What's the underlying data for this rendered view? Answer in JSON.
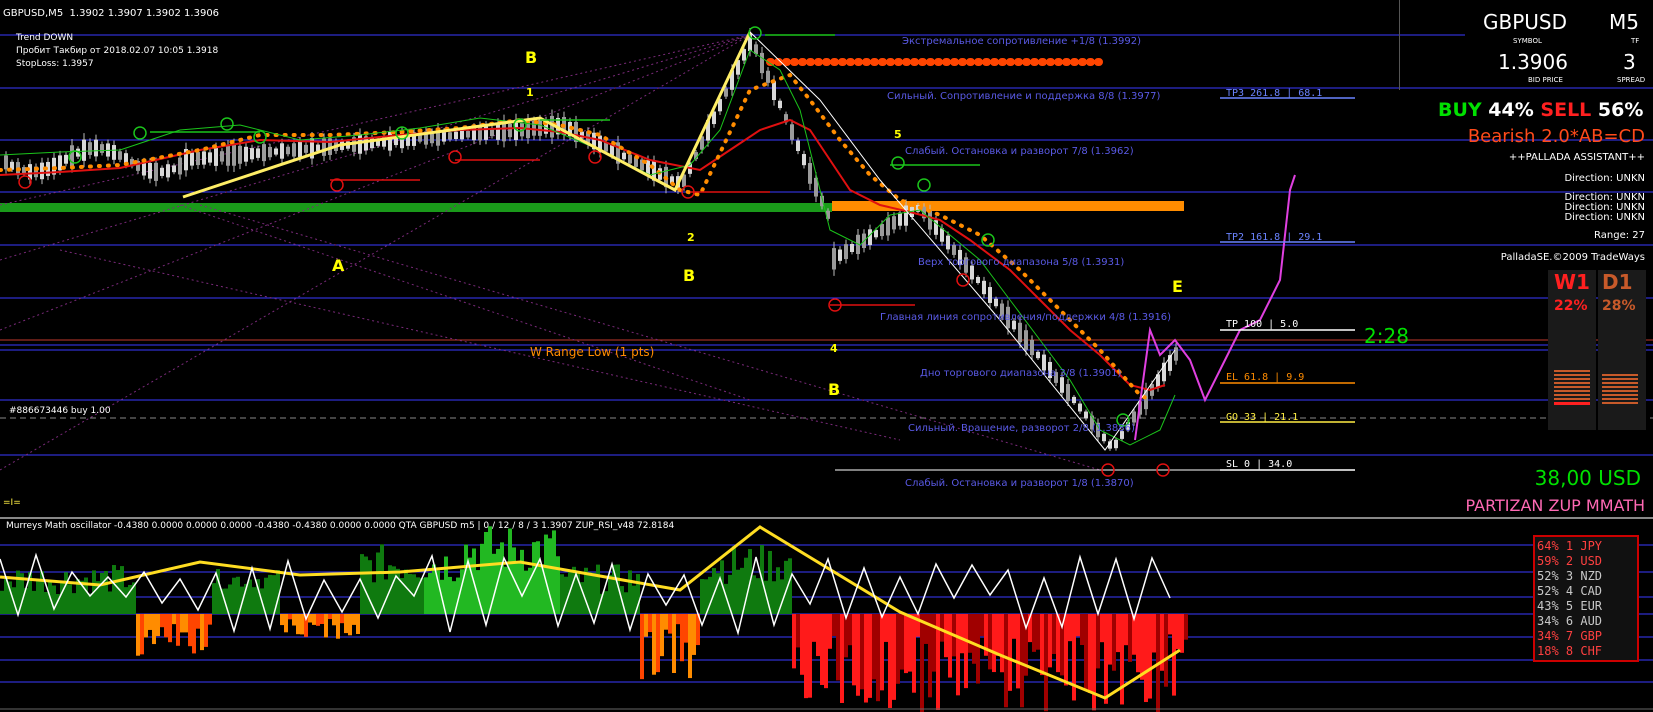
{
  "header": {
    "symbol_tf": "GBPUSD,M5",
    "ohlc": "1.3902 1.3907 1.3902 1.3906"
  },
  "info": {
    "trend": "Trend DOWN",
    "breakout": "Пробит Такбир от 2018.02.07 10:05 1.3918",
    "stoploss": "StopLoss: 1.3957",
    "order": "#886673446 buy 1.00",
    "marker": "=I="
  },
  "levels": {
    "l9": "Экстремальное сопротивление +1/8  (1.3992)",
    "l8": "Сильный. Сопротивление и поддержка 8/8  (1.3977)",
    "l7": "Слабый. Остановка и разворот 7/8  (1.3962)",
    "l5": "Верх торгового диапазона 5/8  (1.3931)",
    "l4": "Главная линия сопротивления/поддержки 4/8  (1.3916)",
    "l3": "Дно торгового диапазона 3/8  (1.3901)",
    "l2": "Сильный. Вращение, разворот 2/8  (1.3886)",
    "l1": "Слабый. Остановка и разворот 1/8  (1.3870)",
    "w_range": "W Range Low (1 pts)"
  },
  "zigzag": {
    "A": "A",
    "B1": "B",
    "B2": "B",
    "B3": "B",
    "E": "E",
    "n1": "1",
    "n2": "2",
    "n4": "4",
    "n5": "5"
  },
  "targets": {
    "tp3": "TP3  261.8  |  68.1",
    "tp2": "TP2  161.8  |  29.1",
    "tp": "TP   100   |  5.0",
    "el": "EL   61.8  |  9.9",
    "go": "GO   33   |  21.1",
    "sl": "SL   0    |  34.0"
  },
  "timer": "2:28",
  "panel": {
    "symbol": "GBPUSD",
    "symbol_label": "SYMBOL",
    "tf": "M5",
    "tf_label": "TF",
    "bid": "1.3906",
    "bid_label": "BID PRICE",
    "spread": "3",
    "spread_label": "SPREAD",
    "buy_label": "BUY",
    "buy_pct": "44%",
    "sell_label": "SELL",
    "sell_pct": "56%",
    "pattern": "Bearish 2.0*AB=CD",
    "assistant": "++PALLADA ASSISTANT++",
    "direction1": "Direction: UNKN",
    "direction2": "Direction: UNKN",
    "direction3": "Direction: UNKN",
    "direction4": "Direction: UNKN",
    "range": "Range: 27",
    "copyright": "PalladaSE.©2009 TradeWays",
    "w1": "W1",
    "d1": "D1",
    "w1_pct": "22%",
    "d1_pct": "28%",
    "profit": "38,00 USD",
    "brand": "PARTIZAN ZUP MMATH"
  },
  "oscillator": {
    "title": "Murreys Math oscillator -0.4380 0.0000 0.0000 0.0000 -0.4380 -0.4380 0.0000 0.0000  QTA GBPUSD m5 | 0 / 12 / 8 / 3 1.3907  ZUP_RSI_v48 72.8184"
  },
  "currencies": [
    {
      "pct": "64%",
      "rank": "1",
      "code": "JPY",
      "color": "#ff4040"
    },
    {
      "pct": "59%",
      "rank": "2",
      "code": "USD",
      "color": "#ff4040"
    },
    {
      "pct": "52%",
      "rank": "3",
      "code": "NZD",
      "color": "#c8c8c8"
    },
    {
      "pct": "52%",
      "rank": "4",
      "code": "CAD",
      "color": "#c8c8c8"
    },
    {
      "pct": "43%",
      "rank": "5",
      "code": "EUR",
      "color": "#c8c8c8"
    },
    {
      "pct": "34%",
      "rank": "6",
      "code": "AUD",
      "color": "#c8c8c8"
    },
    {
      "pct": "34%",
      "rank": "7",
      "code": "GBP",
      "color": "#ff4040"
    },
    {
      "pct": "18%",
      "rank": "8",
      "code": "CHF",
      "color": "#ff4040"
    }
  ],
  "colors": {
    "level_line": "#3a3aff",
    "green_bar": "#1a9a1a",
    "orange_bar": "#ff8c00",
    "zigzag": "#ffee44",
    "buy": "#00e000",
    "sell": "#ff2020"
  }
}
